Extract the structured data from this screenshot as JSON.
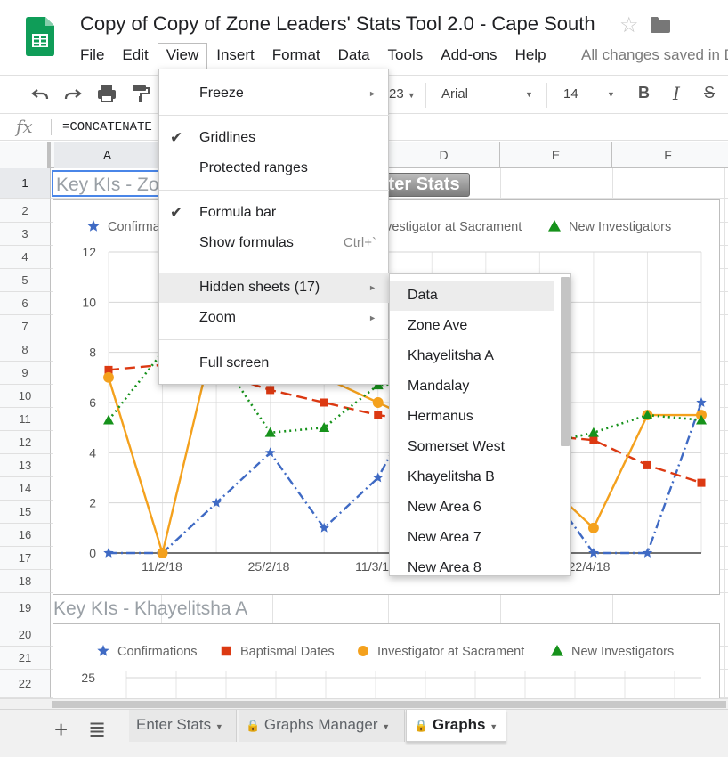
{
  "doc": {
    "title": "Copy of Copy of Zone Leaders' Stats Tool 2.0 - Cape South",
    "save_status": "All changes saved in Drive"
  },
  "menubar": [
    "File",
    "Edit",
    "View",
    "Insert",
    "Format",
    "Data",
    "Tools",
    "Add-ons",
    "Help"
  ],
  "toolbar": {
    "font_size_partial": "23",
    "font": "Arial",
    "size": "14",
    "bold": "B",
    "italic": "I",
    "strike": "S"
  },
  "formula_bar": {
    "fx": "fx",
    "text": "=CONCATENATE"
  },
  "columns": [
    "A",
    "B",
    "C",
    "D",
    "E",
    "F"
  ],
  "rows": [
    "1",
    "2",
    "3",
    "4",
    "5",
    "6",
    "7",
    "8",
    "9",
    "10",
    "11",
    "12",
    "13",
    "14",
    "15",
    "16",
    "17",
    "18",
    "19",
    "20",
    "21",
    "22"
  ],
  "cells": {
    "a1": "Key KIs - Zone",
    "a19": "Key KIs - Khayelitsha A",
    "enter_button": "Enter Stats"
  },
  "view_menu": {
    "items": [
      {
        "label": "Freeze",
        "arrow": "►"
      },
      {
        "label": "Gridlines",
        "check": "✔"
      },
      {
        "label": "Protected ranges"
      },
      {
        "label": "Formula bar",
        "check": "✔"
      },
      {
        "label": "Show formulas",
        "shortcut": "Ctrl+`"
      },
      {
        "label": "Hidden sheets (17)",
        "arrow": "►"
      },
      {
        "label": "Zoom",
        "arrow": "►"
      },
      {
        "label": "Full screen"
      }
    ]
  },
  "hidden_sheets": [
    "Data",
    "Zone Ave",
    "Khayelitsha A",
    "Mandalay",
    "Hermanus",
    "Somerset West",
    "Khayelitsha B",
    "New Area 6",
    "New Area 7",
    "New Area 8"
  ],
  "chart_data": [
    {
      "type": "line",
      "title": "",
      "legend": "top",
      "x_ticks": [
        "11/2/18",
        "25/2/18",
        "11/3/18",
        "8/4/18",
        "22/4/18"
      ],
      "ylim": [
        0,
        12
      ],
      "y_ticks": [
        "0",
        "2",
        "4",
        "6",
        "8",
        "10",
        "12"
      ],
      "grid": true,
      "series": [
        {
          "name": "Confirmations",
          "color": "#3f6ac4",
          "marker": "star",
          "dash": "dashdot",
          "values": [
            0,
            0,
            2,
            4,
            1,
            3,
            7,
            5,
            3,
            0,
            0,
            6
          ]
        },
        {
          "name": "Baptismal Dates",
          "color": "#dc3912",
          "marker": "square",
          "dash": "dash",
          "values": [
            7.3,
            7.5,
            7.2,
            6.5,
            6.0,
            5.5,
            5.2,
            5.0,
            4.7,
            4.5,
            3.5,
            2.8
          ]
        },
        {
          "name": "Investigator at Sacrament",
          "color": "#f4a11d",
          "marker": "circle",
          "dash": "solid",
          "values": [
            7,
            0,
            9,
            8,
            7,
            6,
            5,
            4,
            3,
            1,
            5.5,
            5.5
          ]
        },
        {
          "name": "New Investigators",
          "color": "#16921b",
          "marker": "triangle",
          "dash": "dot",
          "values": [
            5.3,
            8,
            8,
            4.8,
            5,
            6.7,
            6.8,
            6,
            4.3,
            4.8,
            5.5,
            5.3
          ]
        }
      ]
    },
    {
      "type": "line",
      "title": "",
      "legend": "top",
      "y_ticks": [
        "25"
      ],
      "series": [
        {
          "name": "Confirmations",
          "color": "#3f6ac4",
          "marker": "star"
        },
        {
          "name": "Baptismal Dates",
          "color": "#dc3912",
          "marker": "square"
        },
        {
          "name": "Investigator at Sacrament",
          "color": "#f4a11d",
          "marker": "circle"
        },
        {
          "name": "New Investigators",
          "color": "#16921b",
          "marker": "triangle"
        }
      ]
    }
  ],
  "sheet_tabs": [
    {
      "label": "Enter Stats",
      "locked": false
    },
    {
      "label": "Graphs Manager",
      "locked": true
    },
    {
      "label": "Graphs",
      "locked": true,
      "active": true
    }
  ],
  "icons": {
    "add": "+",
    "all_sheets": "≣",
    "star": "☆",
    "lock": "🔒"
  }
}
